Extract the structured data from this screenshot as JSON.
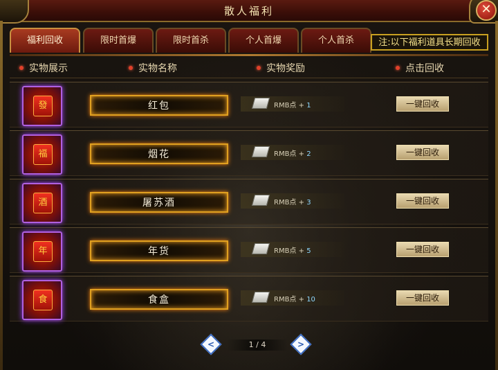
{
  "window": {
    "title": "散人福利",
    "close_label": "✕"
  },
  "tabs": [
    {
      "label": "福利回收",
      "active": true
    },
    {
      "label": "限时首爆",
      "active": false
    },
    {
      "label": "限时首杀",
      "active": false
    },
    {
      "label": "个人首爆",
      "active": false
    },
    {
      "label": "个人首杀",
      "active": false
    }
  ],
  "notice": "注:以下福利道具长期回收",
  "columns": [
    "实物展示",
    "实物名称",
    "实物奖励",
    "点击回收"
  ],
  "items": [
    {
      "name": "红包",
      "icon": "red-envelope-icon",
      "icon_glyph": "發",
      "reward_text": "RMB点 +",
      "reward_value": "1",
      "button": "一键回收"
    },
    {
      "name": "烟花",
      "icon": "fireworks-icon",
      "icon_glyph": "福",
      "reward_text": "RMB点 +",
      "reward_value": "2",
      "button": "一键回收"
    },
    {
      "name": "屠苏酒",
      "icon": "wine-jar-icon",
      "icon_glyph": "酒",
      "reward_text": "RMB点 +",
      "reward_value": "3",
      "button": "一键回收"
    },
    {
      "name": "年货",
      "icon": "new-year-goods-icon",
      "icon_glyph": "年",
      "reward_text": "RMB点 +",
      "reward_value": "5",
      "button": "一键回收"
    },
    {
      "name": "食盒",
      "icon": "food-box-icon",
      "icon_glyph": "食",
      "reward_text": "RMB点 +",
      "reward_value": "10",
      "button": "一键回收"
    }
  ],
  "pager": {
    "prev": "<",
    "next": ">",
    "page_text": "1 / 4"
  },
  "colors": {
    "accent": "#e0a020",
    "tab_active": "#a83a20",
    "reward_value": "#8fd8ff"
  }
}
